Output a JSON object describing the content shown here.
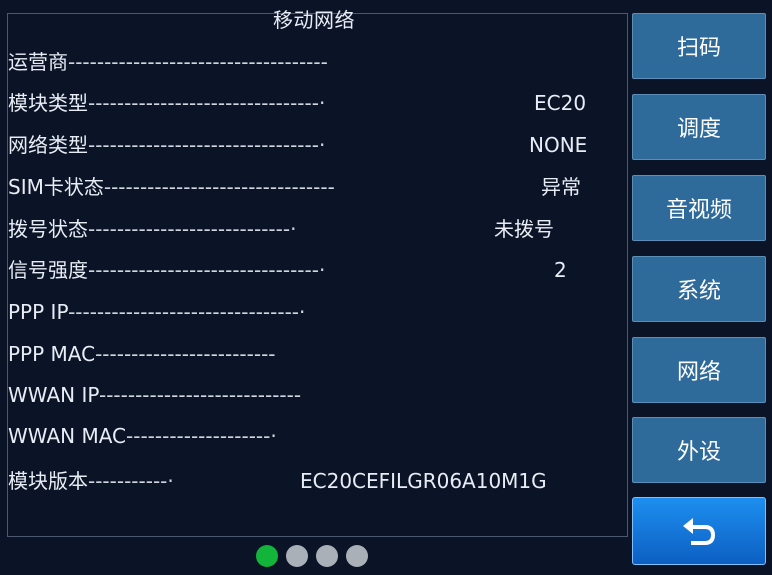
{
  "panel": {
    "title": "移动网络",
    "rows": [
      {
        "label": "运营商",
        "dashes": "------------------------------------",
        "value": ""
      },
      {
        "label": "模块类型",
        "dashes": "--------------------------------·",
        "value": "EC20"
      },
      {
        "label": "网络类型",
        "dashes": "--------------------------------·",
        "value": "NONE"
      },
      {
        "label": "SIM卡状态",
        "dashes": "--------------------------------",
        "value": "异常"
      },
      {
        "label": "拨号状态",
        "dashes": "----------------------------·",
        "value": "未拨号"
      },
      {
        "label": "信号强度",
        "dashes": "--------------------------------·",
        "value": "2"
      },
      {
        "label": "PPP IP",
        "dashes": "--------------------------------·",
        "value": ""
      },
      {
        "label": "PPP MAC",
        "dashes": "-------------------------",
        "value": ""
      },
      {
        "label": "WWAN IP",
        "dashes": "----------------------------",
        "value": ""
      },
      {
        "label": "WWAN MAC",
        "dashes": "--------------------·",
        "value": ""
      },
      {
        "label": "模块版本",
        "dashes": "-----------·",
        "value": "EC20CEFILGR06A10M1G"
      }
    ]
  },
  "sidebar": {
    "buttons": [
      "扫码",
      "调度",
      "音视频",
      "系统",
      "网络",
      "外设"
    ],
    "back_icon": "return-arrow-icon"
  },
  "pager": {
    "total": 4,
    "active_index": 0
  },
  "colors": {
    "background": "#0b1426",
    "button": "#2e6b9a",
    "back_button": "#1477dd",
    "dot_active": "#12b43a",
    "dot_inactive": "#aab0b8"
  }
}
